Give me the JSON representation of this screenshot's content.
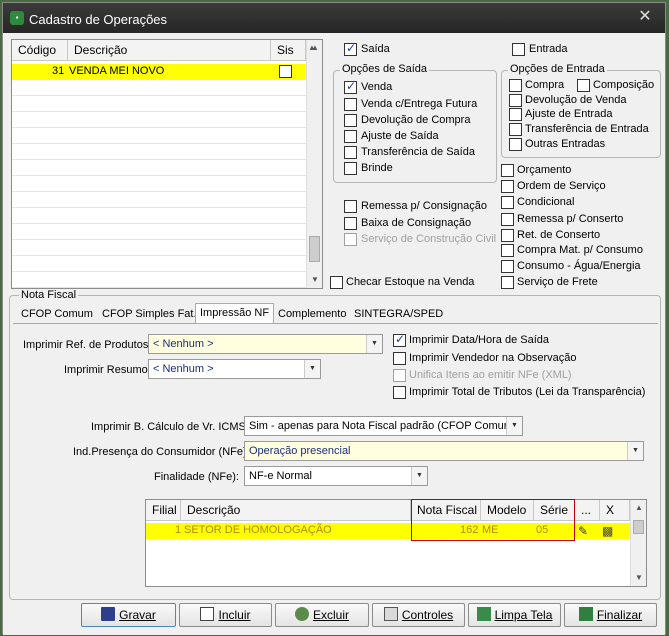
{
  "window": {
    "title": "Cadastro de Operações"
  },
  "top_grid": {
    "columns": [
      "Código",
      "Descrição",
      "Sis"
    ],
    "row": {
      "codigo": "31",
      "descricao": "VENDA MEI NOVO"
    }
  },
  "saida_label": "Saída",
  "entrada_label": "Entrada",
  "opcoes_saida": {
    "title": "Opções de Saída",
    "items": [
      "Venda",
      "Venda c/Entrega Futura",
      "Devolução de Compra",
      "Ajuste de Saída",
      "Transferência de Saída",
      "Brinde"
    ]
  },
  "opcoes_entrada": {
    "title": "Opções de Entrada",
    "items": [
      "Compra",
      "Composição",
      "Devolução de Venda",
      "Ajuste de Entrada",
      "Transferência de Entrada",
      "Outras Entradas"
    ]
  },
  "right_options": [
    "Orçamento",
    "Ordem de Serviço",
    "Condicional",
    "Remessa p/ Conserto",
    "Ret. de Conserto",
    "Compra Mat. p/ Consumo",
    "Consumo - Água/Energia",
    "Serviço de Frete"
  ],
  "consig": {
    "remessa": "Remessa p/ Consignação",
    "baixa": "Baixa de Consignação",
    "servico": "Serviço de Construção Civil"
  },
  "checar_estoque": "Checar Estoque na Venda",
  "nota_fiscal": {
    "title": "Nota Fiscal",
    "tabs": [
      "CFOP Comum",
      "CFOP Simples Fat.",
      "Impressão NF",
      "Complemento",
      "SINTEGRA/SPED"
    ],
    "imprimir_ref_label": "Imprimir Ref. de Produtos:",
    "imprimir_ref_value": "< Nenhum >",
    "imprimir_resumo_label": "Imprimir Resumo:",
    "imprimir_resumo_value": "< Nenhum >",
    "checks": [
      "Imprimir Data/Hora de Saída",
      "Imprimir Vendedor na Observação",
      "Unifica Itens ao emitir NFe (XML)",
      "Imprimir Total de Tributos (Lei da Transparência)"
    ],
    "icms_label": "Imprimir B. Cálculo de Vr. ICMS:",
    "icms_value": "Sim - apenas para Nota Fiscal padrão (CFOP Comum)",
    "presenca_label": "Ind.Presença do Consumidor (NFe):",
    "presenca_value": "Operação presencial",
    "finalidade_label": "Finalidade (NFe):",
    "finalidade_value": "NF-e Normal"
  },
  "filial_grid": {
    "columns": [
      "Filial",
      "Descrição",
      "Nota Fiscal",
      "Modelo",
      "Série",
      "...",
      "X"
    ],
    "row": {
      "filial": "1",
      "descricao": "SETOR DE HOMOLOGAÇÃO",
      "nota": "162",
      "modelo": "ME",
      "serie": "05"
    }
  },
  "buttons": [
    "Gravar",
    "Incluir",
    "Excluir",
    "Controles",
    "Limpa Tela",
    "Finalizar"
  ]
}
